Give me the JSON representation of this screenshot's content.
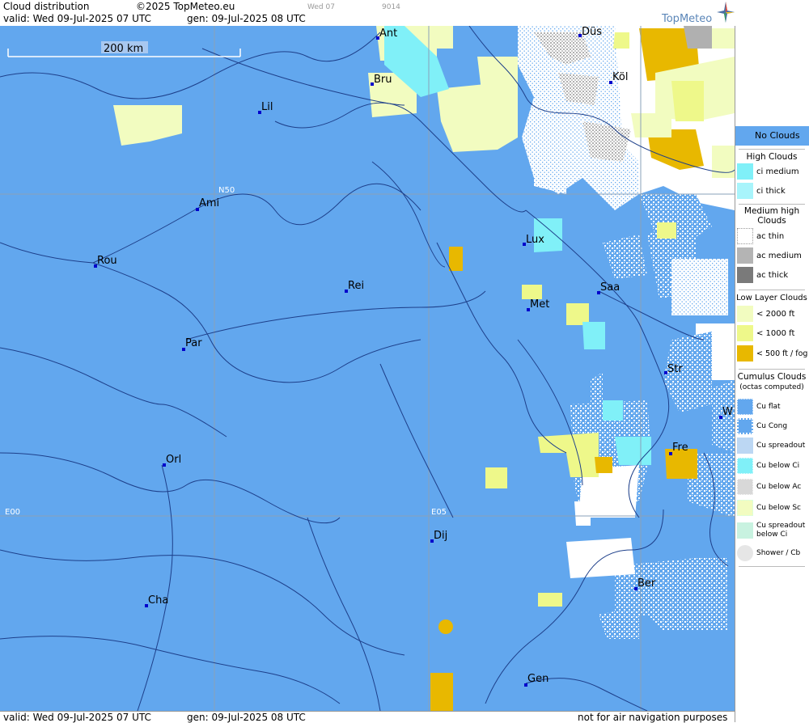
{
  "header": {
    "title": "Cloud distribution",
    "copyright": "©2025 TopMeteo.eu",
    "day_small": "Wed 07",
    "code_small": "9014",
    "valid": "valid:  Wed  09-Jul-2025  07 UTC",
    "gen": "gen: 09-Jul-2025 08 UTC",
    "logo": "TopMeteo"
  },
  "footer": {
    "valid": "valid:  Wed  09-Jul-2025  07 UTC",
    "gen": "gen: 09-Jul-2025 08 UTC",
    "disclaimer": "not for air navigation purposes"
  },
  "map": {
    "scale_label": "200 km",
    "grid_labels": {
      "n50": "N50",
      "e00": "E00",
      "e05": "E05"
    },
    "cities": [
      {
        "name": "Ant"
      },
      {
        "name": "Düs"
      },
      {
        "name": "Bru"
      },
      {
        "name": "Köl"
      },
      {
        "name": "Lil"
      },
      {
        "name": "Ami"
      },
      {
        "name": "Lux"
      },
      {
        "name": "Rou"
      },
      {
        "name": "Rei"
      },
      {
        "name": "Saa"
      },
      {
        "name": "Met"
      },
      {
        "name": "Par"
      },
      {
        "name": "Str"
      },
      {
        "name": "W"
      },
      {
        "name": "Fre"
      },
      {
        "name": "Orl"
      },
      {
        "name": "Dij"
      },
      {
        "name": "Ber"
      },
      {
        "name": "Cha"
      },
      {
        "name": "Gen"
      }
    ],
    "colors": {
      "no_clouds": "#62a7ee",
      "ci": "#80f0f8",
      "low_2000": "#f2fcc0",
      "low_1000": "#eef88a",
      "low_500": "#e8b800",
      "ac": "#ffffff"
    }
  },
  "legend": {
    "no_clouds": "No Clouds",
    "high_clouds": "High Clouds",
    "ci_medium": "ci medium",
    "ci_thick": "ci thick",
    "medium_high_clouds": "Medium high Clouds",
    "ac_thin": "ac thin",
    "ac_medium": "ac medium",
    "ac_thick": "ac thick",
    "low_layer_clouds": "Low Layer Clouds",
    "lt2000": "< 2000 ft",
    "lt1000": "< 1000 ft",
    "lt500": "< 500 ft / fog",
    "cumulus_clouds": "Cumulus Clouds",
    "octas": "(octas computed)",
    "cu_flat": "Cu flat",
    "cu_cong": "Cu Cong",
    "cu_spreadout": "Cu spreadout",
    "cu_below_ci": "Cu below Ci",
    "cu_below_ac": "Cu below Ac",
    "cu_below_sc": "Cu below Sc",
    "cu_spreadout_below_ci": "Cu spreadout below Ci",
    "shower_cb": "Shower / Cb"
  }
}
